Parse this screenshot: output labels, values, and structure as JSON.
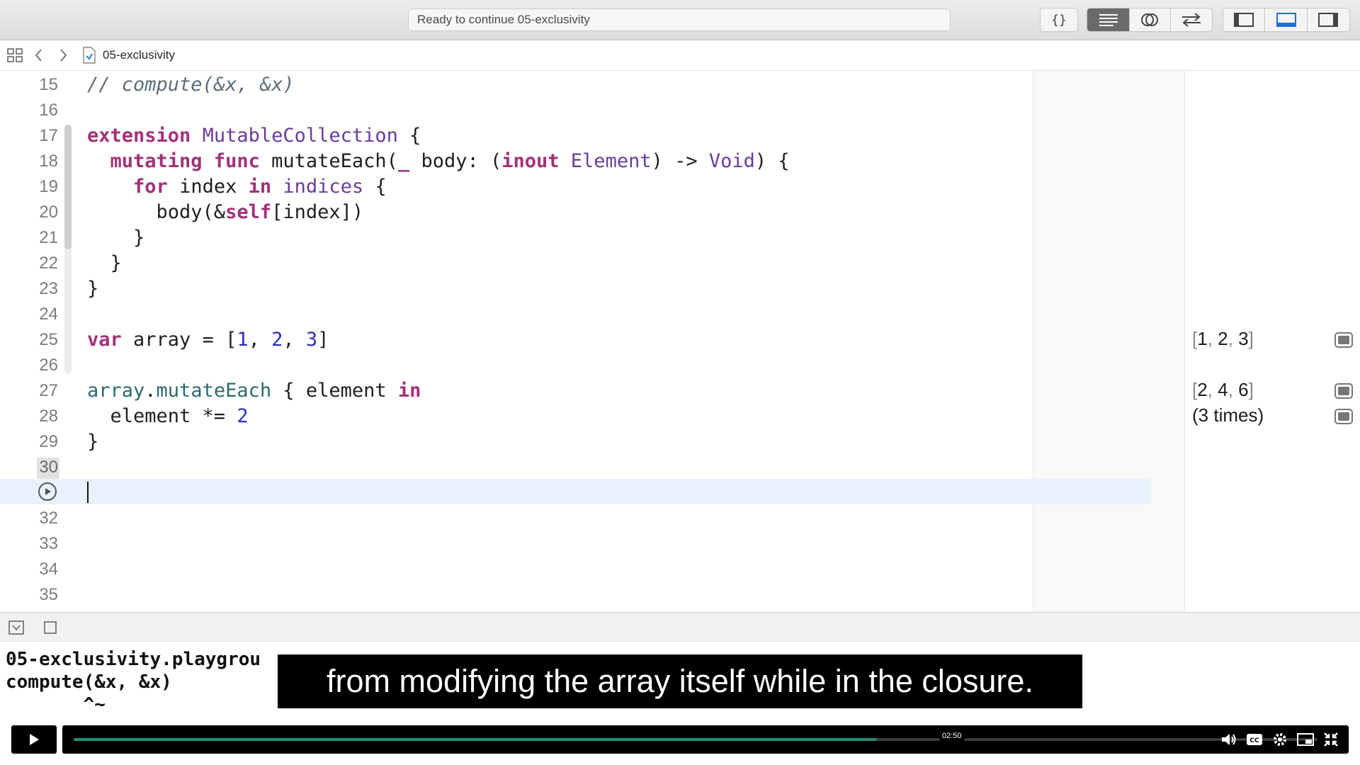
{
  "toolbar": {
    "status_text": "Ready to continue 05-exclusivity",
    "icons": [
      "braces-icon",
      "standard-editor-icon",
      "assistant-editor-icon",
      "version-editor-icon",
      "navigator-panel-icon",
      "debug-area-icon",
      "inspector-panel-icon"
    ]
  },
  "jumpbar": {
    "file_name": "05-exclusivity"
  },
  "editor": {
    "line_numbers": [
      "15",
      "16",
      "17",
      "18",
      "19",
      "20",
      "21",
      "22",
      "23",
      "24",
      "25",
      "26",
      "27",
      "28",
      "29",
      "30",
      "32",
      "33",
      "34",
      "35"
    ]
  },
  "results": {
    "array_open": "[",
    "array1_v1": "1",
    "array1_v2": "2",
    "array1_v3": "3",
    "array2_v1": "2",
    "array2_v2": "4",
    "array2_v3": "6",
    "comma": ",",
    "array_close": "]",
    "times": "(3 times)"
  },
  "console": {
    "line1": "05-exclusivity.playgrou",
    "line2": "compute(&x, &x)",
    "line3": "       ^~"
  },
  "subtitle": "from modifying the array itself while in the closure.",
  "video": {
    "time": "02:50",
    "progress": 0.646
  }
}
